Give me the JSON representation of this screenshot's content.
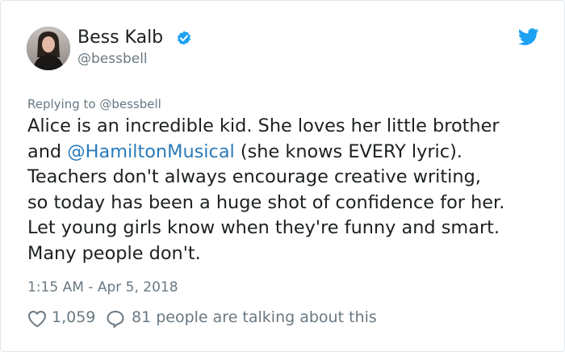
{
  "author": {
    "name": "Bess Kalb",
    "handle": "@bessbell"
  },
  "reply_to": "Replying to @bessbell",
  "tweet": {
    "line1": "Alice is an incredible kid. She loves her little brother",
    "line2_prefix": "and ",
    "line2_mention": "@HamiltonMusical",
    "line2_suffix": " (she knows EVERY lyric).",
    "line3": "Teachers don't always encourage creative writing,",
    "line4": "so today has been a huge shot of confidence for her.",
    "line5": "Let young girls know when they're funny and smart.",
    "line6": "Many people don't."
  },
  "timestamp": "1:15 AM - Apr 5, 2018",
  "actions": {
    "likes": "1,059",
    "talking": "81 people are talking about this"
  },
  "colors": {
    "text": "#1c2022",
    "secondary": "#697882",
    "link": "#2b7bb9",
    "twitter_blue": "#1da1f2"
  },
  "icons": {
    "verified": "verified-badge-icon",
    "brand": "twitter-bird-icon",
    "like": "heart-icon",
    "reply": "speech-bubble-icon"
  }
}
